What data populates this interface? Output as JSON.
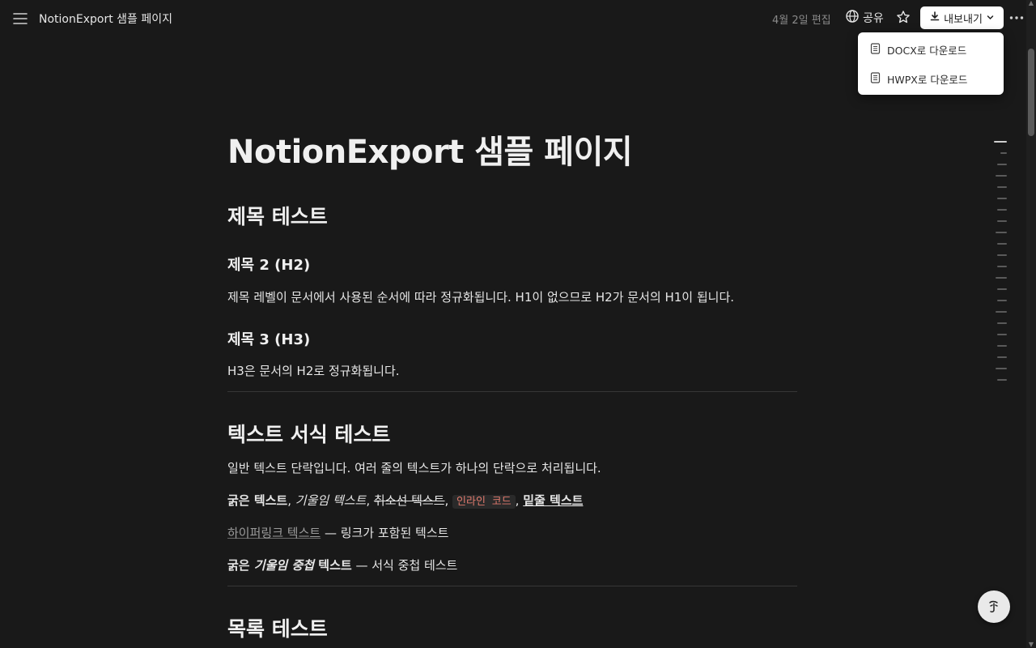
{
  "topbar": {
    "breadcrumb": "NotionExport 샘플 페이지",
    "edited": "4월 2일 편집",
    "share_label": "공유",
    "export_label": "내보내기",
    "menu_icon": "hamburger-menu-icon",
    "more_icon": "more-horizontal-icon",
    "star_icon": "star-icon"
  },
  "export_menu": {
    "items": [
      {
        "label": "DOCX로 다운로드",
        "icon": "document-icon"
      },
      {
        "label": "HWPX로 다운로드",
        "icon": "document-icon"
      }
    ]
  },
  "doc": {
    "title": "NotionExport 샘플 페이지",
    "sec1_heading": "제목 테스트",
    "h2": "제목 2 (H2)",
    "h2_para": "제목 레벨이 문서에서 사용된 순서에 따라 정규화됩니다. H1이 없으므로 H2가 문서의 H1이 됩니다.",
    "h3": "제목 3 (H3)",
    "h3_para": "H3은 문서의 H2로 정규화됩니다.",
    "sec2_heading": "텍스트 서식 테스트",
    "plain_para": "일반 텍스트 단락입니다. 여러 줄의 텍스트가 하나의 단락으로 처리됩니다.",
    "fmt": {
      "bold": "굵은 텍스트",
      "sep1": ", ",
      "italic": "기울임 텍스트",
      "sep2": ", ",
      "strike": "취소선 텍스트",
      "sep3": ", ",
      "code": "인라인 코드",
      "sep4": ", ",
      "underline": "밑줄 텍스트"
    },
    "link_text": "하이퍼링크 텍스트",
    "link_suffix": " — 링크가 포함된 텍스트",
    "nested": {
      "bold_start": "굵은 ",
      "bold_italic": "기울임 중첩",
      "bold_end": " 텍스트",
      "suffix": " — 서식 중첩 테스트"
    },
    "sec3_heading": "목록 테스트"
  },
  "colors": {
    "background": "#191919",
    "text": "#e6e6e6",
    "code_text": "#e07a6d",
    "muted": "#8a8a8a"
  },
  "floating": {
    "help_icon": "notion-ai-face-icon"
  }
}
